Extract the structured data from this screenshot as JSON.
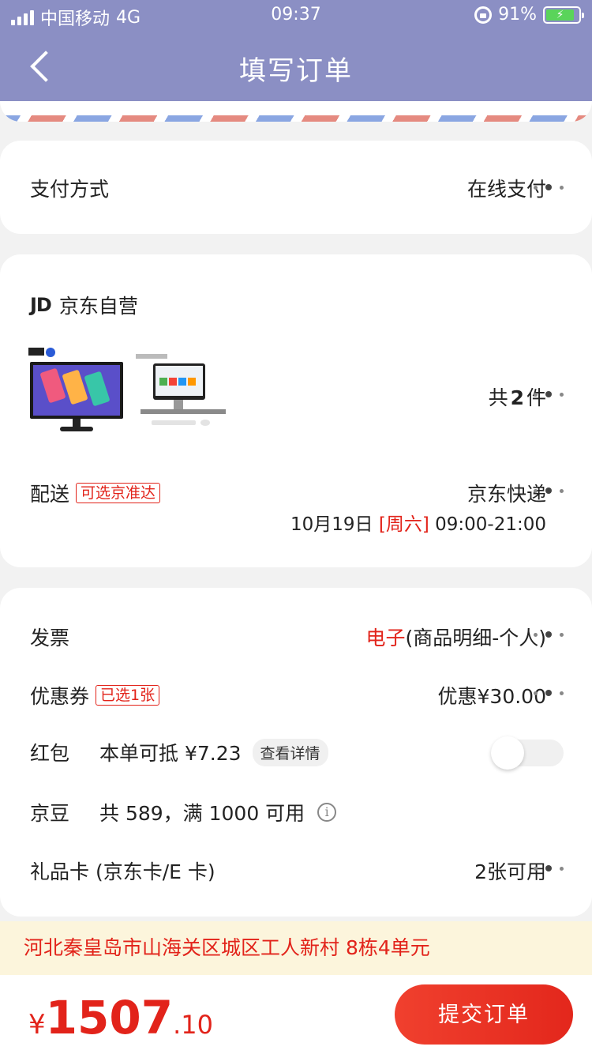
{
  "status_bar": {
    "carrier": "中国移动",
    "network": "4G",
    "time": "09:37",
    "battery": "91%"
  },
  "nav": {
    "title": "填写订单"
  },
  "payment": {
    "label": "支付方式",
    "value": "在线支付"
  },
  "shop": {
    "logo": "JD",
    "name": "京东自营",
    "count_prefix": "共",
    "count": "2",
    "count_suffix": "件",
    "delivery_label": "配送",
    "delivery_tag": "可选京准达",
    "delivery_value": "京东快递",
    "delivery_date": "10月19日",
    "delivery_weekday": "[周六]",
    "delivery_time": "09:00-21:00"
  },
  "extras": {
    "invoice_label": "发票",
    "invoice_type": "电子",
    "invoice_detail": "(商品明细-个人)",
    "coupon_label": "优惠券",
    "coupon_tag": "已选1张",
    "coupon_value": "优惠¥30.00",
    "redpacket_label": "红包",
    "redpacket_text": "本单可抵 ¥7.23",
    "redpacket_detail": "查看详情",
    "redpacket_enabled": false,
    "jingdou_label": "京豆",
    "jingdou_text": "共 589，满 1000 可用",
    "giftcard_label": "礼品卡 (京东卡/E 卡)",
    "giftcard_value": "2张可用"
  },
  "address": "河北秦皇岛市山海关区城区工人新村 8栋4单元",
  "bottom": {
    "currency": "¥",
    "price_int": "1507",
    "price_dec": ".10",
    "submit_label": "提交订单"
  },
  "colors": {
    "header": "#8b8fc4",
    "accent": "#e2231a",
    "address_bg": "#fcf5dc"
  }
}
